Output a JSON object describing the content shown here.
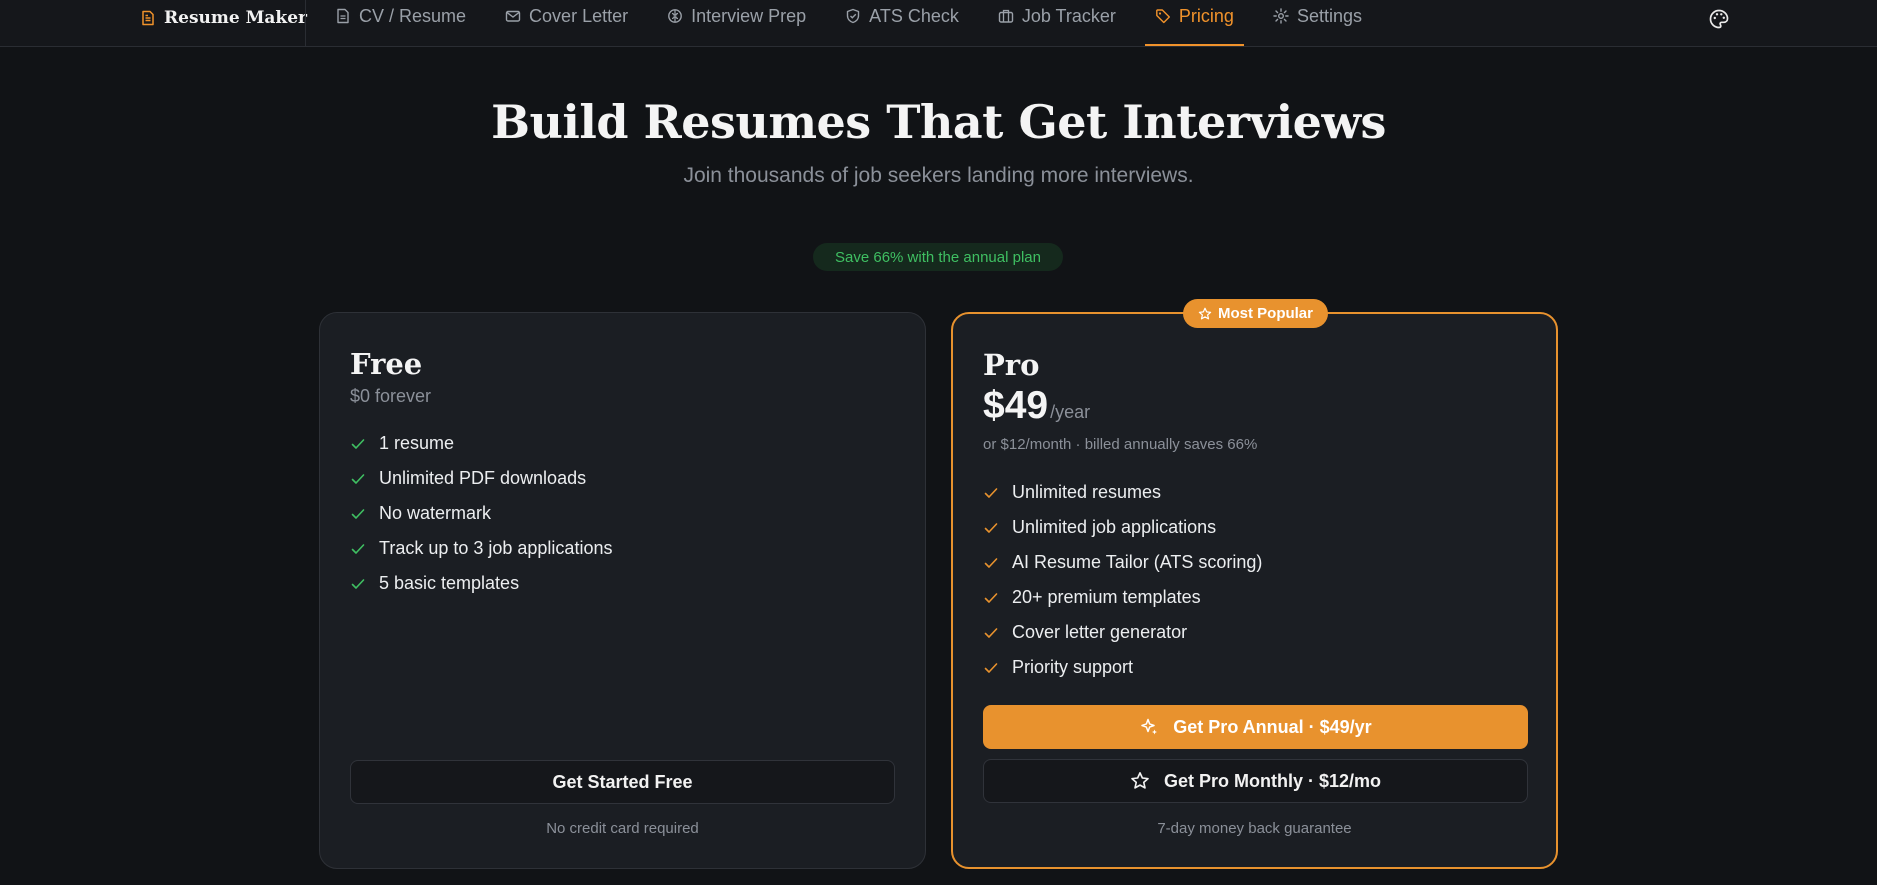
{
  "app": {
    "brand_label": "Resume Maker",
    "accent_color": "#f0922b"
  },
  "nav": {
    "items": [
      {
        "label": "CV / Resume",
        "icon": "document-icon",
        "active": false
      },
      {
        "label": "Cover Letter",
        "icon": "mail-icon",
        "active": false
      },
      {
        "label": "Interview Prep",
        "icon": "brain-icon",
        "active": false
      },
      {
        "label": "ATS Check",
        "icon": "shield-check-icon",
        "active": false
      },
      {
        "label": "Job Tracker",
        "icon": "briefcase-icon",
        "active": false
      },
      {
        "label": "Pricing",
        "icon": "tag-icon",
        "active": true
      },
      {
        "label": "Settings",
        "icon": "gear-icon",
        "active": false
      }
    ],
    "theme_icon": "palette-icon"
  },
  "hero": {
    "title": "Build Resumes That Get Interviews",
    "subtitle": "Join thousands of job seekers landing more interviews.",
    "save_pill": "Save 66% with the annual plan"
  },
  "plans": {
    "free": {
      "name": "Free",
      "price": "$0 forever",
      "features": [
        "1 resume",
        "Unlimited PDF downloads",
        "No watermark",
        "Track up to 3 job applications",
        "5 basic templates"
      ],
      "cta": "Get Started Free",
      "note": "No credit card required"
    },
    "pro": {
      "badge": "Most Popular",
      "name": "Pro",
      "amount": "$49",
      "period": "/year",
      "billing": "or $12/month · billed annually saves 66%",
      "features": [
        "Unlimited resumes",
        "Unlimited job applications",
        "AI Resume Tailor (ATS scoring)",
        "20+ premium templates",
        "Cover letter generator",
        "Priority support"
      ],
      "cta_annual": "Get Pro Annual · $49/yr",
      "cta_monthly": "Get Pro Monthly · $12/mo",
      "note": "7-day money back guarantee"
    }
  }
}
